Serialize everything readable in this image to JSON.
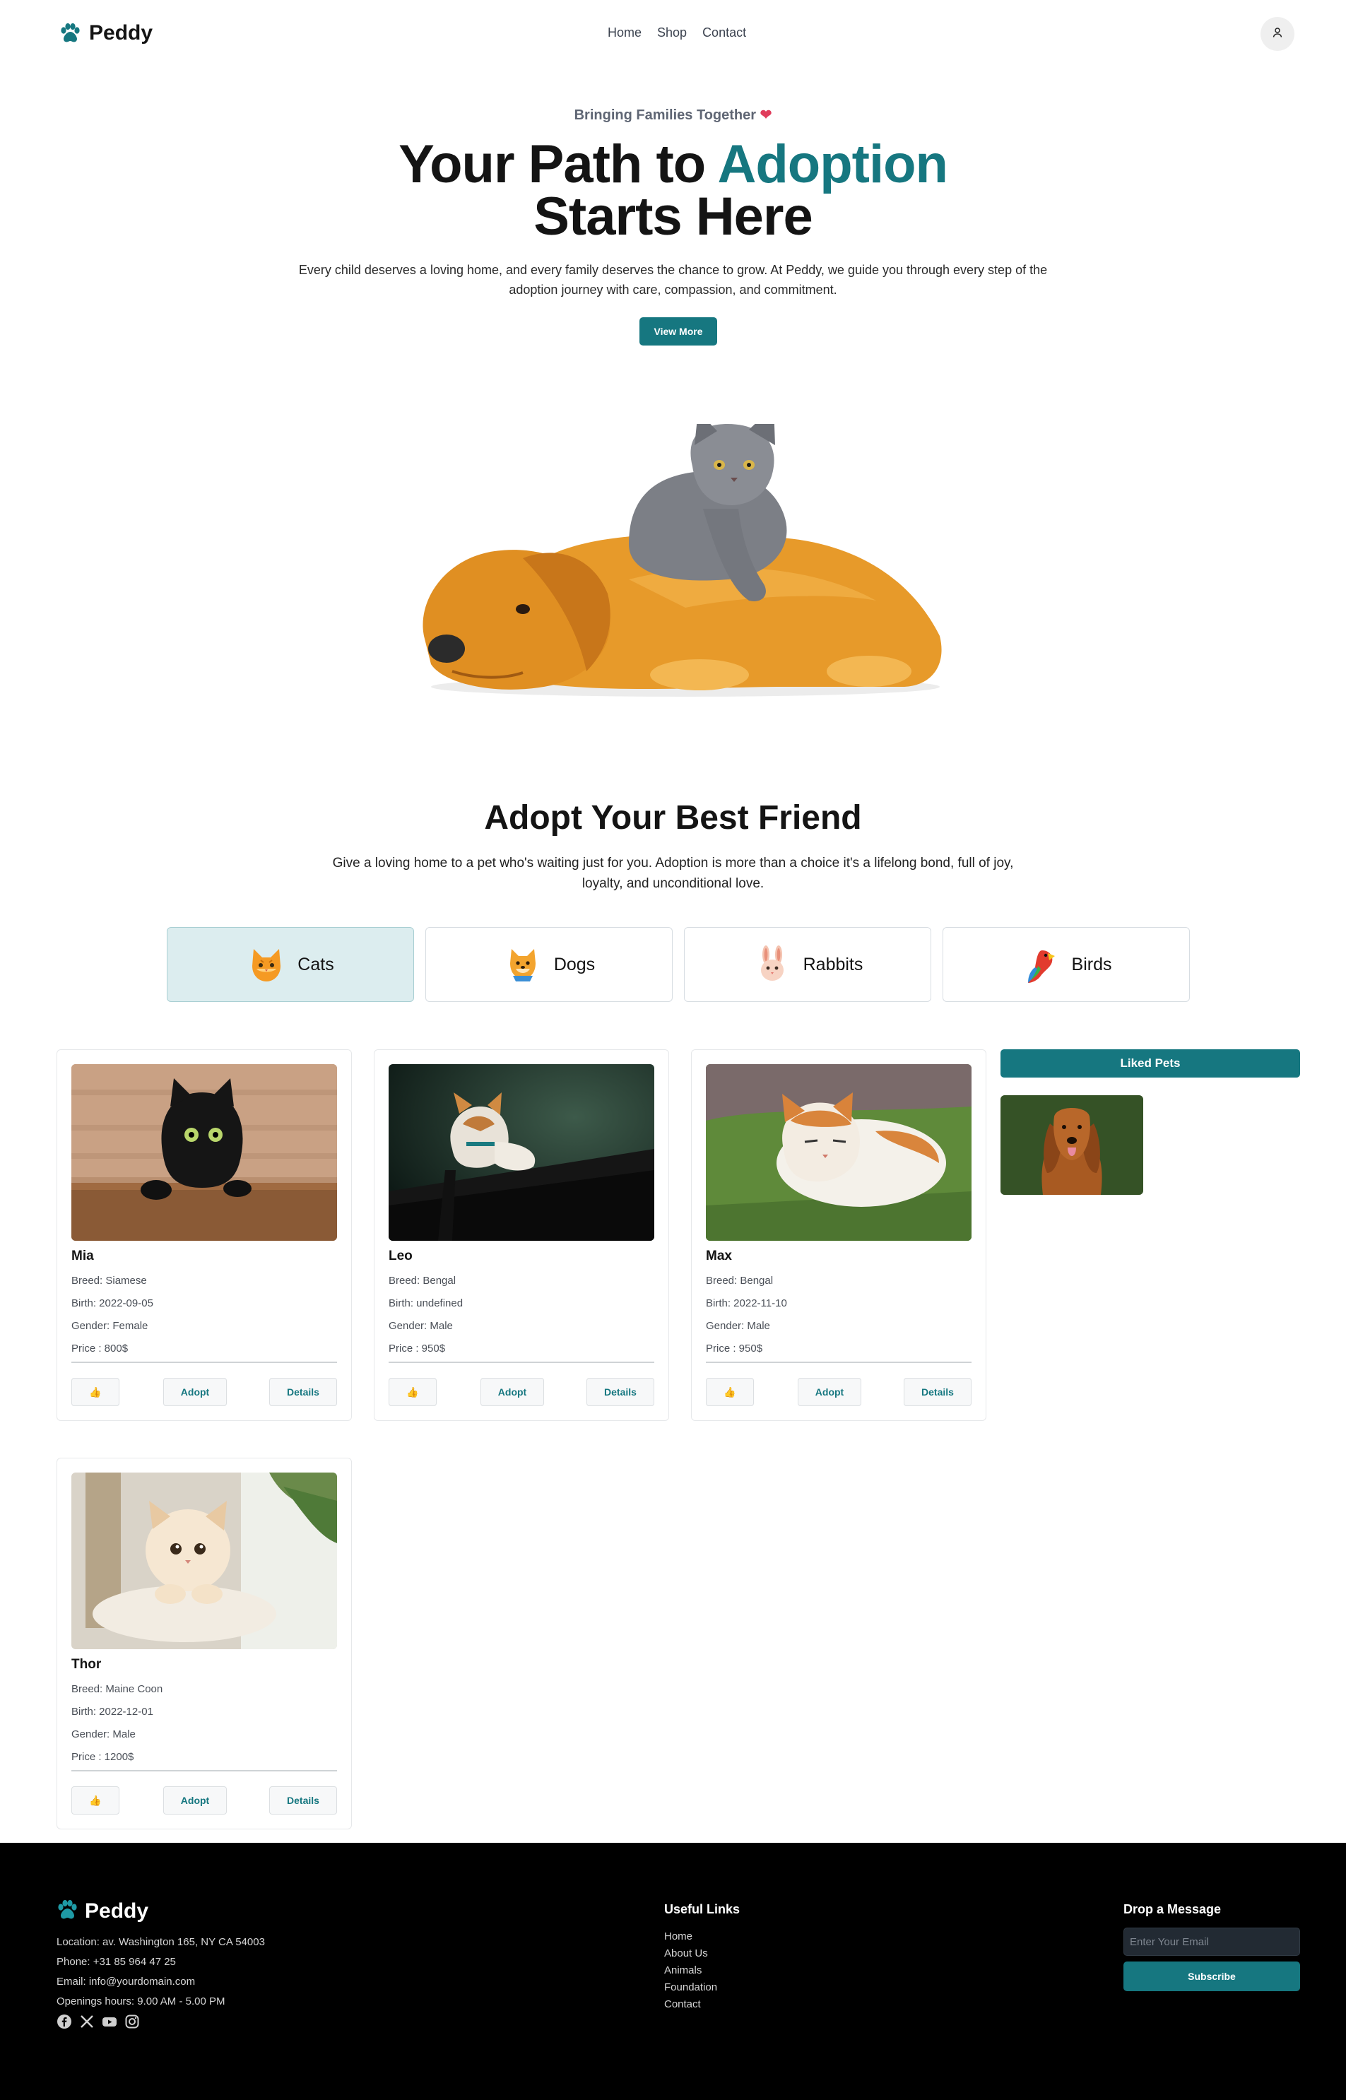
{
  "brand": {
    "name": "Peddy",
    "accent": "#167780"
  },
  "nav": {
    "items": [
      "Home",
      "Shop",
      "Contact"
    ]
  },
  "hero": {
    "kicker": "Bringing Families Together",
    "kicker_icon": "heart-icon",
    "title_part1": "Your Path to ",
    "title_accent": "Adoption",
    "title_part2": "Starts Here",
    "description": "Every child deserves a loving home, and every family deserves the chance to grow. At Peddy, we guide you through every step of the adoption journey with care, compassion, and commitment.",
    "cta_label": "View More"
  },
  "adopt": {
    "title": "Adopt Your Best Friend",
    "description": "Give a loving home to a pet who's waiting just for you. Adoption is more than a choice it's a lifelong bond, full of joy, loyalty, and unconditional love.",
    "categories": [
      {
        "label": "Cats",
        "icon": "cat-emoji-icon",
        "active": true
      },
      {
        "label": "Dogs",
        "icon": "dog-emoji-icon",
        "active": false
      },
      {
        "label": "Rabbits",
        "icon": "rabbit-emoji-icon",
        "active": false
      },
      {
        "label": "Birds",
        "icon": "parrot-emoji-icon",
        "active": false
      }
    ]
  },
  "pets": [
    {
      "name": "Mia",
      "breed": "Breed: Siamese",
      "birth": "Birth: 2022-09-05",
      "gender": "Gender: Female",
      "price": "Price : 800$"
    },
    {
      "name": "Leo",
      "breed": "Breed: Bengal",
      "birth": "Birth: undefined",
      "gender": "Gender: Male",
      "price": "Price : 950$"
    },
    {
      "name": "Max",
      "breed": "Breed: Bengal",
      "birth": "Birth: 2022-11-10",
      "gender": "Gender: Male",
      "price": "Price : 950$"
    },
    {
      "name": "Thor",
      "breed": "Breed: Maine Coon",
      "birth": "Birth: 2022-12-01",
      "gender": "Gender: Male",
      "price": "Price : 1200$"
    }
  ],
  "card_actions": {
    "like_icon": "thumbs-up-icon",
    "adopt_label": "Adopt",
    "details_label": "Details"
  },
  "liked": {
    "title": "Liked Pets"
  },
  "footer": {
    "brand": "Peddy",
    "location": "Location: av. Washington 165, NY CA 54003",
    "phone": "Phone: +31 85 964 47 25",
    "email": "Email: info@yourdomain.com",
    "hours": "Openings hours: 9.00 AM - 5.00 PM",
    "links_title": "Useful Links",
    "links": [
      "Home",
      "About Us",
      "Animals",
      "Foundation",
      "Contact"
    ],
    "message_title": "Drop a Message",
    "email_placeholder": "Enter Your Email",
    "subscribe_label": "Subscribe",
    "socials": [
      "facebook-icon",
      "x-icon",
      "youtube-icon",
      "instagram-icon"
    ]
  }
}
